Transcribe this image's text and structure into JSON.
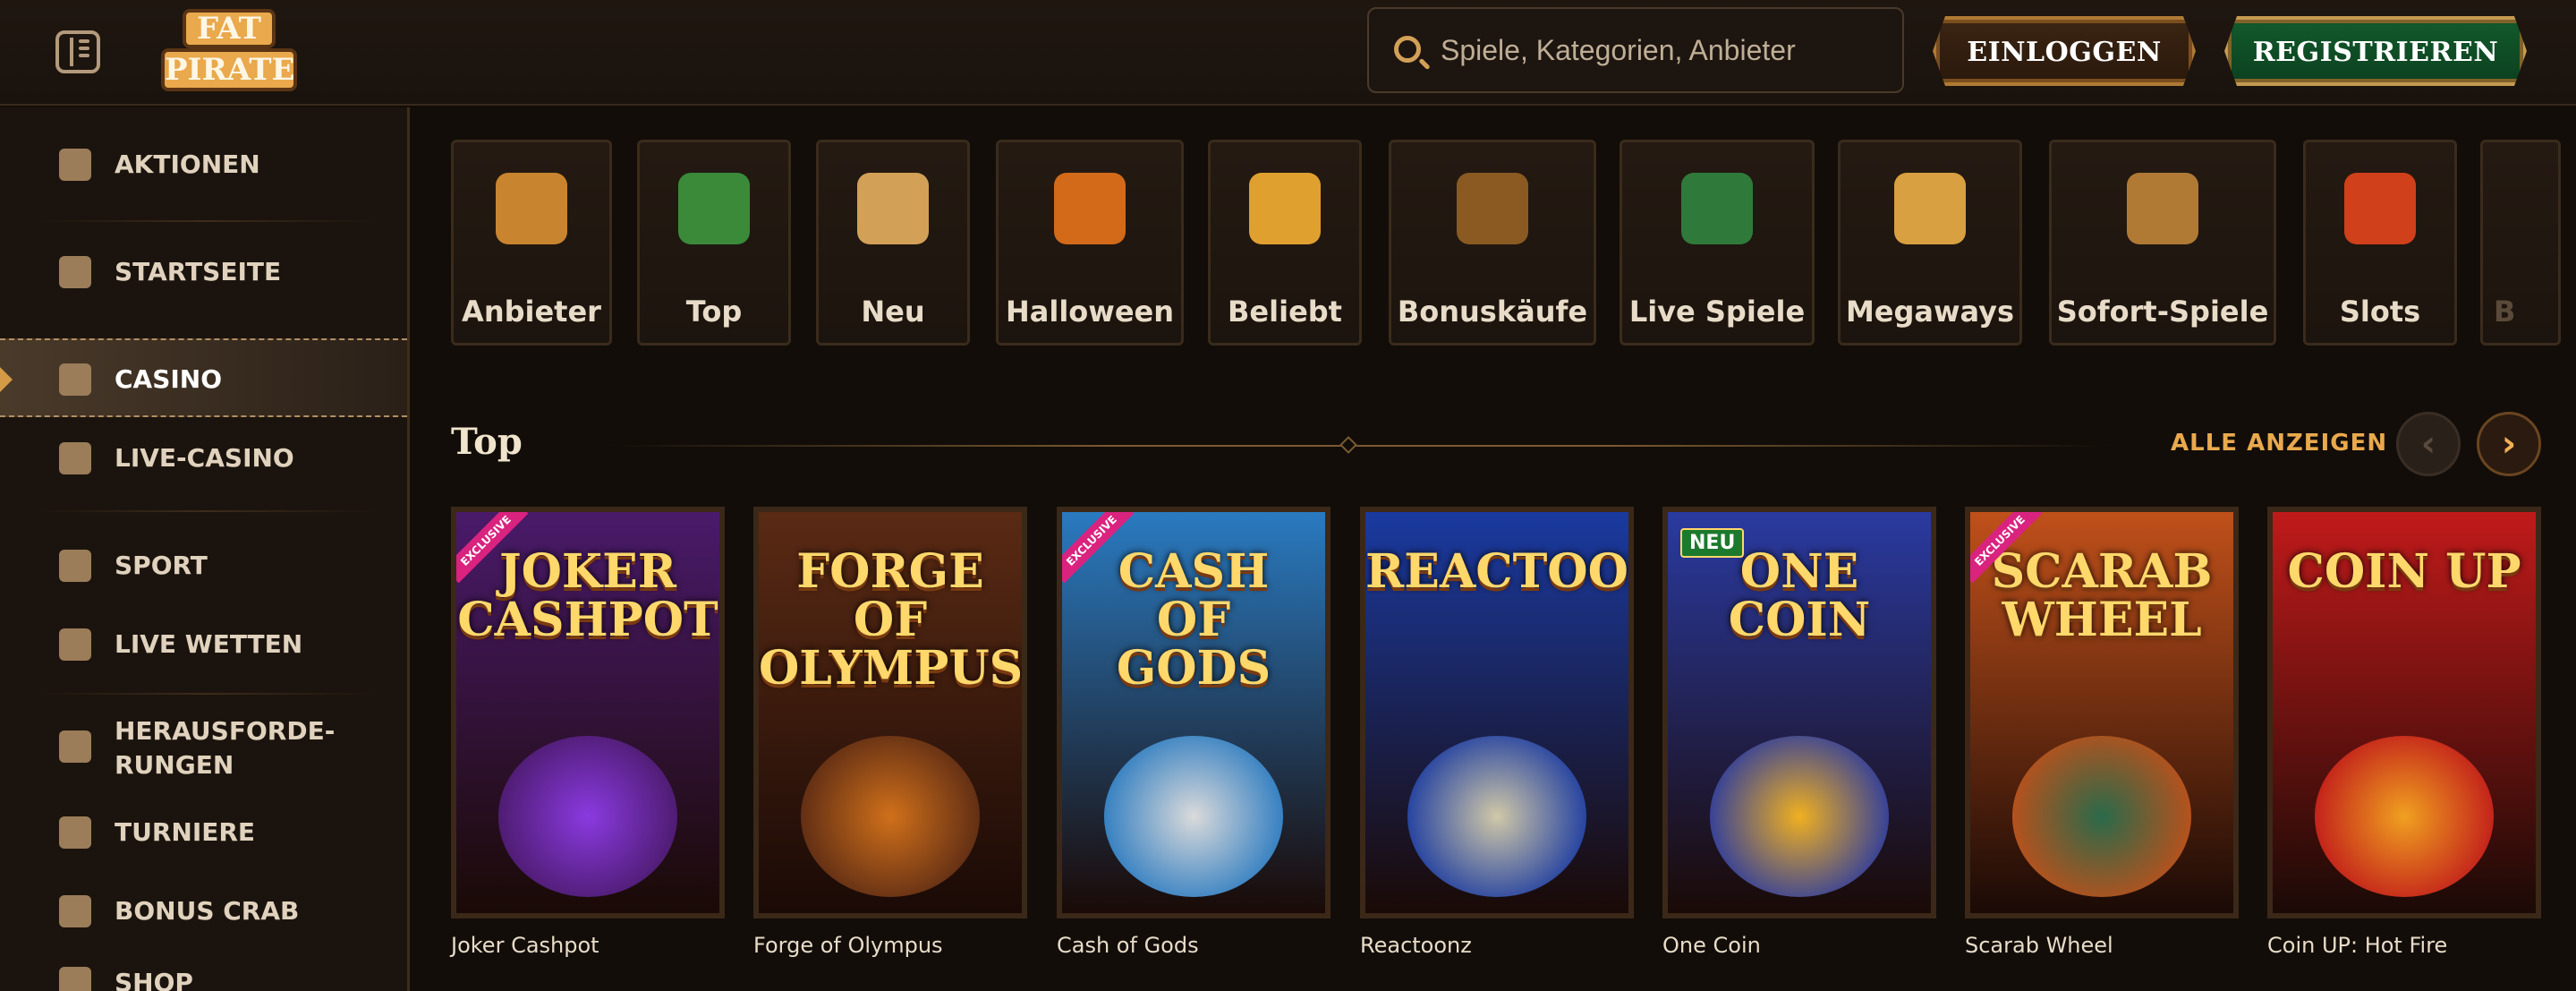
{
  "header": {
    "logo": {
      "line1": "FAT",
      "line2": "PIRATE"
    },
    "search_placeholder": "Spiele, Kategorien, Anbieter",
    "login_label": "EINLOGGEN",
    "register_label": "REGISTRIEREN"
  },
  "sidebar": {
    "items": [
      {
        "label": "AKTIONEN",
        "icon": "promotions-icon"
      },
      {
        "label": "STARTSEITE",
        "icon": "home-icon"
      },
      {
        "label": "CASINO",
        "icon": "casino-icon",
        "active": true
      },
      {
        "label": "LIVE-CASINO",
        "icon": "live-casino-icon"
      },
      {
        "label": "SPORT",
        "icon": "sport-icon"
      },
      {
        "label": "LIVE WETTEN",
        "icon": "live-bet-icon"
      },
      {
        "label": "HERAUSFORDE-\nRUNGEN",
        "icon": "challenges-icon"
      },
      {
        "label": "TURNIERE",
        "icon": "trophy-icon"
      },
      {
        "label": "BONUS CRAB",
        "icon": "crab-icon"
      },
      {
        "label": "SHOP",
        "icon": "shop-icon"
      }
    ]
  },
  "categories": [
    {
      "label": "Anbieter",
      "icon": "scroll-icon",
      "color": "#c9842f"
    },
    {
      "label": "Top",
      "icon": "star-icon",
      "color": "#3a8a3a"
    },
    {
      "label": "Neu",
      "icon": "goblet-icon",
      "color": "#d2a057"
    },
    {
      "label": "Halloween",
      "icon": "pumpkin-icon",
      "color": "#d26a1a"
    },
    {
      "label": "Beliebt",
      "icon": "crown-icon",
      "color": "#e0a030"
    },
    {
      "label": "Bonuskäufe",
      "icon": "chest-icon",
      "color": "#8a5a22"
    },
    {
      "label": "Live Spiele",
      "icon": "cards-icon",
      "color": "#2f7a3a"
    },
    {
      "label": "Megaways",
      "icon": "m-icon",
      "color": "#d8a040"
    },
    {
      "label": "Sofort-Spiele",
      "icon": "joystick-icon",
      "color": "#b07a35"
    },
    {
      "label": "Slots",
      "icon": "cherries-icon",
      "color": "#d0401a"
    },
    {
      "label": "B",
      "icon": "partial-icon",
      "color": "#3a2b1c"
    }
  ],
  "section": {
    "title": "Top",
    "show_all": "ALLE ANZEIGEN",
    "prev": "‹",
    "next": "›"
  },
  "games": [
    {
      "name": "Joker Cashpot",
      "art_title": "JOKER\nCASHPOT",
      "badge": "EXCLUSIVE",
      "bg": "#4a1a6a",
      "orb": "#8a3ae0"
    },
    {
      "name": "Forge of Olympus",
      "art_title": "FORGE\nOF\nOLYMPUS",
      "badge": "",
      "bg": "#5a2a14",
      "orb": "#d0701a"
    },
    {
      "name": "Cash of Gods",
      "art_title": "CASH\nOF\nGODS",
      "badge": "EXCLUSIVE",
      "bg": "#2a7ac0",
      "orb": "#dadada"
    },
    {
      "name": "Reactoonz",
      "art_title": "REACTOONZ",
      "badge": "",
      "bg": "#1a3aa0",
      "orb": "#d0c8a8"
    },
    {
      "name": "One Coin",
      "art_title": "ONE COIN",
      "badge": "",
      "newbadge": "NEU",
      "bg": "#2a3aa0",
      "orb": "#f0b020"
    },
    {
      "name": "Scarab Wheel",
      "art_title": "SCARAB\nWHEEL",
      "badge": "EXCLUSIVE",
      "bg": "#c0501a",
      "orb": "#2a6a4a"
    },
    {
      "name": "Coin UP: Hot Fire",
      "art_title": "COIN UP",
      "badge": "",
      "bg": "#c01a1a",
      "orb": "#f0a020"
    }
  ]
}
